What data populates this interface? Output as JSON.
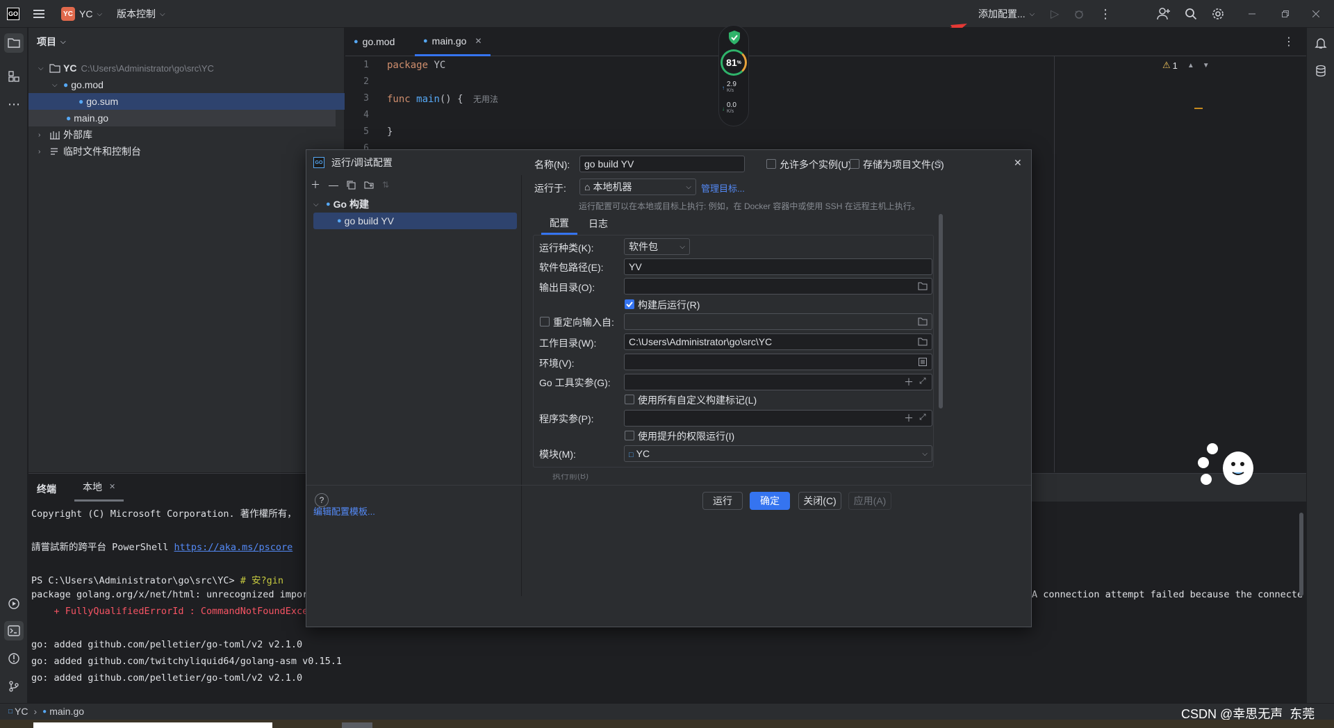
{
  "titlebar": {
    "logo": "GO",
    "project_badge": "YC",
    "project_name": "YC",
    "vcs_label": "版本控制",
    "add_config_label": "添加配置..."
  },
  "sidebar_left": {
    "icons": [
      "folder-icon",
      "structure-icon",
      "more-icon",
      "services-icon",
      "terminal-icon",
      "problems-icon",
      "git-icon"
    ]
  },
  "project_panel": {
    "title": "项目",
    "tree": [
      {
        "label": "YC",
        "path": "C:\\Users\\Administrator\\go\\src\\YC"
      },
      {
        "label": "go.mod"
      },
      {
        "label": "go.sum"
      },
      {
        "label": "main.go"
      },
      {
        "label": "外部库"
      },
      {
        "label": "临时文件和控制台"
      }
    ]
  },
  "editor": {
    "tabs": [
      {
        "label": "go.mod"
      },
      {
        "label": "main.go"
      }
    ],
    "lines": [
      "1",
      "2",
      "3",
      "4",
      "5",
      "6"
    ],
    "code": {
      "line1_kw": "package",
      "line1_name": "YC",
      "line3_kw": "func",
      "line3_name": "main",
      "line3_rest": "() {",
      "line3_hint": "无用法",
      "line5": "}"
    },
    "warnings": "1"
  },
  "netmon": {
    "percent": "81",
    "percent_unit": "%",
    "up": "2.9",
    "up_unit": "K/s",
    "down": "0.0",
    "down_unit": "K/s"
  },
  "terminal": {
    "title": "终端",
    "tab": "本地",
    "lines": [
      "Copyright (C) Microsoft Corporation. 著作權所有，",
      "",
      "請嘗試新的跨平台 PowerShell ",
      "",
      "PS C:\\Users\\Administrator\\go\\src\\YC> ",
      "package golang.org/x/net/html: unrecognized impor",
      "    + FullyQualifiedErrorId : CommandNotFoundExce",
      "",
      "go: added github.com/pelletier/go-toml/v2 v2.1.0",
      "go: added github.com/twitchyliquid64/golang-asm v0.15.1",
      "go: added github.com/pelletier/go-toml/v2 v2.1.0"
    ],
    "link": "https://aka.ms/pscore",
    "command": "# 安?gin",
    "right_text": "A connection attempt failed because the connecte"
  },
  "statusbar": {
    "crumb_project": "YC",
    "crumb_file": "main.go",
    "watermark": "CSDN @幸思无声_东莞"
  },
  "dialog": {
    "title": "运行/调试配置",
    "tree_group": "Go 构建",
    "tree_item": "go build YV",
    "edit_templates": "编辑配置模板...",
    "name_label": "名称(N):",
    "name_value": "go build YV",
    "allow_multiple": "允许多个实例(U)",
    "store_as_file": "存储为项目文件(S)",
    "run_on_label": "运行于:",
    "run_on_value": "本地机器",
    "manage_targets": "管理目标...",
    "run_on_hint": "运行配置可以在本地或目标上执行: 例如，在 Docker 容器中或使用 SSH 在远程主机上执行。",
    "tabs": [
      "配置",
      "日志"
    ],
    "run_kind_label": "运行种类(K):",
    "run_kind_value": "软件包",
    "pkg_path_label": "软件包路径(E):",
    "pkg_path_value": "YV",
    "output_dir_label": "输出目录(O):",
    "run_after_build": "构建后运行(R)",
    "redirect_input": "重定向输入自:",
    "work_dir_label": "工作目录(W):",
    "work_dir_value": "C:\\Users\\Administrator\\go\\src\\YC",
    "env_label": "环境(V):",
    "go_tool_args_label": "Go 工具实参(G):",
    "use_custom_tags": "使用所有自定义构建标记(L)",
    "program_args_label": "程序实参(P):",
    "run_elevated": "使用提升的权限运行(I)",
    "module_label": "模块(M):",
    "module_value": "YC",
    "cut_off_label": "执行前(B)",
    "buttons": {
      "run": "运行",
      "ok": "确定",
      "close": "关闭(C)",
      "apply": "应用(A)"
    },
    "help": "?"
  },
  "colors": {
    "accent": "#3574f0",
    "keyword": "#cf8e6d",
    "function": "#56a8f5",
    "error": "#f75464",
    "link": "#548af7"
  }
}
